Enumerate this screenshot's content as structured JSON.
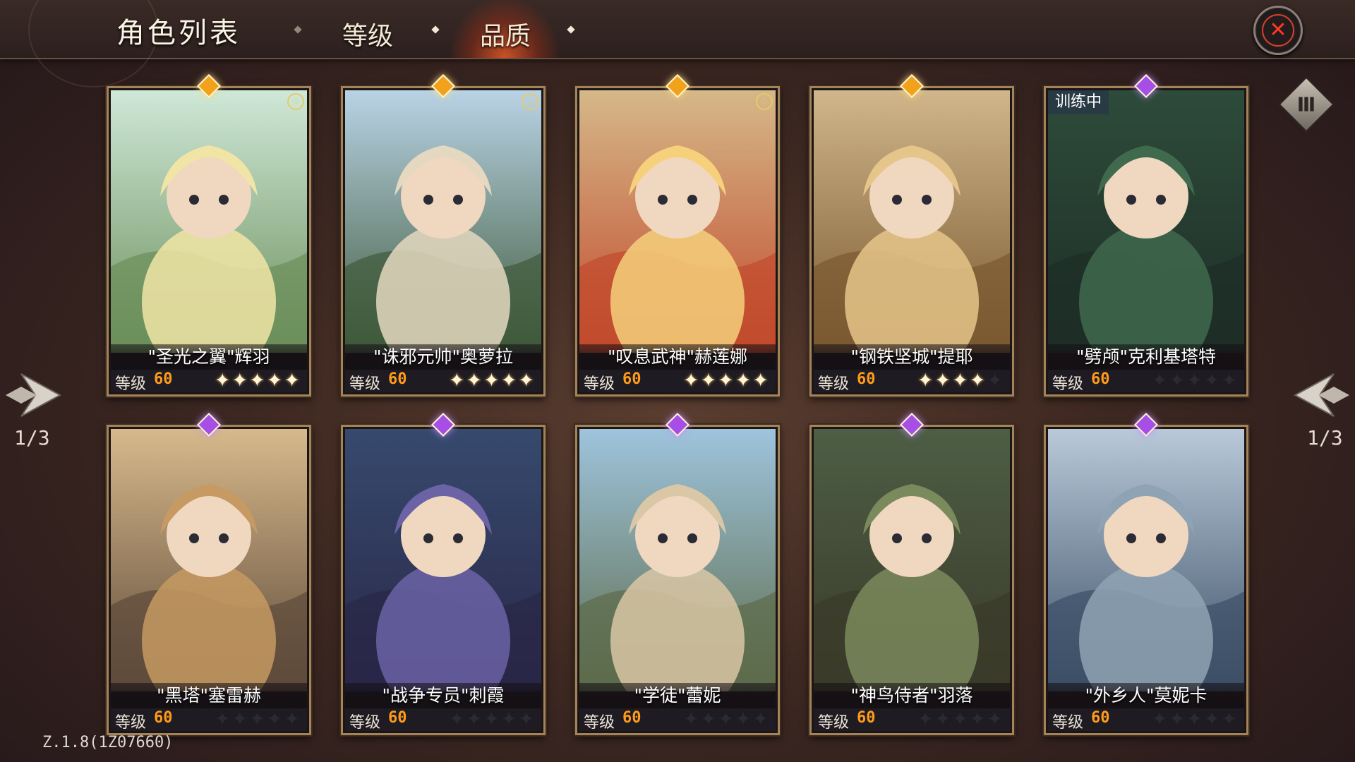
{
  "header": {
    "title": "角色列表",
    "tabs": [
      {
        "label": "等级",
        "active": false
      },
      {
        "label": "品质",
        "active": true
      }
    ]
  },
  "pager": {
    "left": "1/3",
    "right": "1/3"
  },
  "version": "Z.1.8(1Z07660)",
  "level_label": "等级",
  "cards": [
    {
      "name": "\"圣光之翼\"辉羽",
      "level": "60",
      "stars": 5,
      "rarity": "gold",
      "badge": "☆",
      "status": ""
    },
    {
      "name": "\"诛邪元帅\"奥萝拉",
      "level": "60",
      "stars": 5,
      "rarity": "gold",
      "badge": "☆",
      "status": ""
    },
    {
      "name": "\"叹息武神\"赫莲娜",
      "level": "60",
      "stars": 5,
      "rarity": "gold",
      "badge": "☆",
      "status": ""
    },
    {
      "name": "\"钢铁坚城\"提耶",
      "level": "60",
      "stars": 4,
      "rarity": "gold",
      "badge": "",
      "status": ""
    },
    {
      "name": "\"劈颅\"克利基塔特",
      "level": "60",
      "stars": 0,
      "rarity": "purple",
      "badge": "",
      "status": "训练中"
    },
    {
      "name": "\"黑塔\"塞雷赫",
      "level": "60",
      "stars": 0,
      "rarity": "purple",
      "badge": "",
      "status": ""
    },
    {
      "name": "\"战争专员\"刺霞",
      "level": "60",
      "stars": 0,
      "rarity": "purple",
      "badge": "",
      "status": ""
    },
    {
      "name": "\"学徒\"蕾妮",
      "level": "60",
      "stars": 0,
      "rarity": "purple",
      "badge": "",
      "status": ""
    },
    {
      "name": "\"神鸟侍者\"羽落",
      "level": "60",
      "stars": 0,
      "rarity": "purple",
      "badge": "",
      "status": ""
    },
    {
      "name": "\"外乡人\"莫妮卡",
      "level": "60",
      "stars": 0,
      "rarity": "purple",
      "badge": "",
      "status": ""
    }
  ],
  "colors": {
    "gold_gem": "#f1a21a",
    "purple_gem": "#a64ee6",
    "level_value": "#ff9b18",
    "close_accent": "#ff3a22"
  },
  "icons": {
    "close": "close-icon",
    "menu": "menu-icon",
    "prev": "prev-arrow-icon",
    "next": "next-arrow-icon"
  }
}
